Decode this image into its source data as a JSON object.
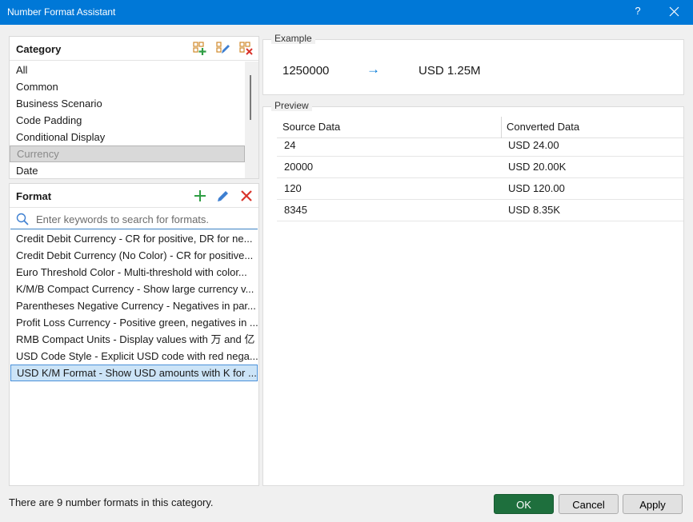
{
  "window": {
    "title": "Number Format Assistant",
    "help": "?"
  },
  "category": {
    "title": "Category",
    "items": [
      "All",
      "Common",
      "Business Scenario",
      "Code Padding",
      "Conditional Display",
      "Currency",
      "Date"
    ],
    "selected": "Currency"
  },
  "format": {
    "title": "Format",
    "search_placeholder": "Enter keywords to search for formats.",
    "items": [
      "Credit Debit Currency - CR for positive, DR for ne...",
      "Credit Debit Currency (No Color) - CR for positive...",
      "Euro Threshold Color - Multi-threshold with color...",
      "K/M/B Compact Currency - Show large currency v...",
      "Parentheses Negative Currency - Negatives in par...",
      "Profit Loss Currency - Positive green, negatives in ...",
      "RMB Compact Units - Display values with 万 and 亿",
      "USD Code Style - Explicit USD code with red nega...",
      "USD K/M Format - Show USD amounts with K for ..."
    ],
    "selected": "USD K/M Format - Show USD amounts with K for ..."
  },
  "example": {
    "label": "Example",
    "source": "1250000",
    "arrow": "→",
    "result": "USD 1.25M"
  },
  "preview": {
    "label": "Preview",
    "columns": [
      "Source Data",
      "Converted Data"
    ],
    "rows": [
      [
        "24",
        "USD 24.00"
      ],
      [
        "20000",
        "USD 20.00K"
      ],
      [
        "120",
        "USD 120.00"
      ],
      [
        "8345",
        "USD 8.35K"
      ]
    ]
  },
  "status_text": "There are 9 number formats in this category.",
  "buttons": {
    "ok": "OK",
    "cancel": "Cancel",
    "apply": "Apply"
  },
  "colors": {
    "titlebar": "#0078d7",
    "accent": "#1e6f3d",
    "selection": "#cce4f7"
  }
}
